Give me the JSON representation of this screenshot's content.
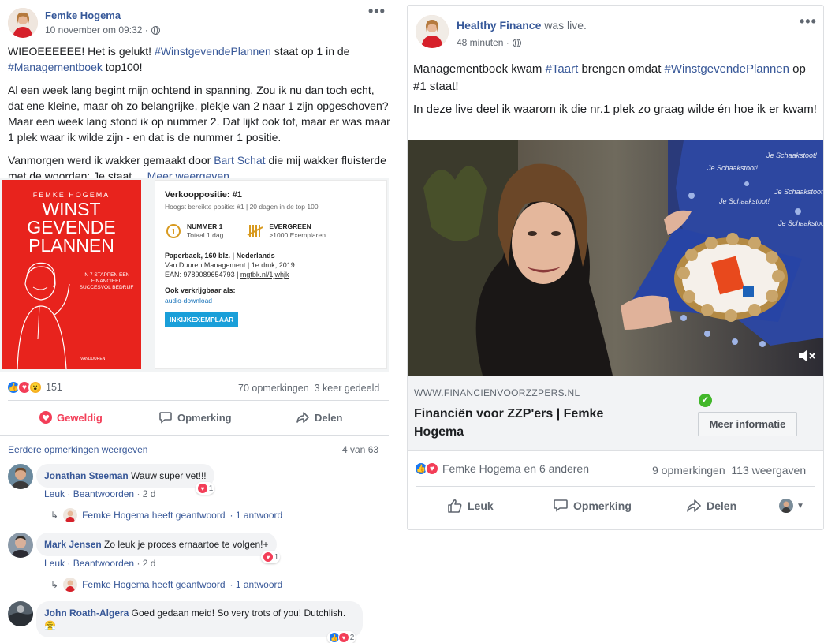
{
  "left_post": {
    "author": "Femke Hogema",
    "timestamp": "10 november om 09:32 ·",
    "more": "•••",
    "p1_a": "WIEOEEEEEE! Het is gelukt! ",
    "p1_tag1": "#WinstgevendePlannen",
    "p1_b": " staat op 1 in de ",
    "p1_tag2": "#Managementboek",
    "p1_c": " top100!",
    "p2": "Al een week lang begint mijn ochtend in spanning. Zou ik nu dan toch echt, dat ene kleine, maar oh zo belangrijke, plekje van 2 naar 1 zijn opgeschoven? Maar een week lang stond ik op nummer 2. Dat lijkt ook tof, maar er was maar 1 plek waar ik wilde zijn - en dat is de nummer 1 positie.",
    "p3_a": "Vanmorgen werd ik wakker gemaakt door ",
    "p3_link": "Bart Schat",
    "p3_b": " die mij wakker fluisterde met de woorden: Je staat ... ",
    "p3_more": "Meer weergeven",
    "book": {
      "cover_author": "FEMKE HOGEMA",
      "cover_title_1": "WINST",
      "cover_title_2": "GEVENDE",
      "cover_title_3": "PLANNEN",
      "cover_sub": "IN 7 STAPPEN EEN FINANCIEEL SUCCESVOL BEDRIJF",
      "cover_publisher": "VANDUUREN",
      "sales_title": "Verkooppositie: #1",
      "sales_sub": "Hoogst bereikte positie: #1 | 20 dagen in de top 100",
      "badge1_title": "NUMMER 1",
      "badge1_sub": "Totaal 1 dag",
      "badge2_title": "EVERGREEN",
      "badge2_sub": ">1000 Exemplaren",
      "format": "Paperback, 160 blz. | Nederlands",
      "publisher": "Van Duuren Management | 1e druk, 2019",
      "ean_label": "EAN: 9789089654793 | ",
      "ean_link": "mgtbk.nl/1jwhjk",
      "also": "Ook verkrijgbaar als:",
      "audio": "audio-download",
      "button": "INKIJKEXEMPLAAR"
    },
    "reaction_count": "151",
    "comments_count": "70 opmerkingen",
    "shares_count": "3 keer gedeeld",
    "action_love": "Geweldig",
    "action_comment": "Opmerking",
    "action_share": "Delen",
    "earlier_comments": "Eerdere opmerkingen weergeven",
    "page_count": "4 van 63",
    "comments": [
      {
        "name": "Jonathan Steeman",
        "text": " Wauw super vet!!!",
        "like": "Leuk",
        "reply": "Beantwoorden",
        "age": "· 2 d",
        "reacts": "1",
        "reply_name": "Femke Hogema heeft geantwoord",
        "reply_count": "· 1 antwoord"
      },
      {
        "name": "Mark Jensen",
        "text": " Zo leuk je proces ernaartoe te volgen!+",
        "like": "Leuk",
        "reply": "Beantwoorden",
        "age": "· 2 d",
        "reacts": "1",
        "reply_name": "Femke Hogema heeft geantwoord",
        "reply_count": "· 1 antwoord"
      },
      {
        "name": "John Roath-Algera",
        "text": " Goed gedaan meid! So very trots of you! Dutchlish. 😤",
        "reacts": "2"
      }
    ]
  },
  "right_post": {
    "author": "Healthy Finance",
    "status": " was live.",
    "timestamp": "48 minuten ·",
    "more": "•••",
    "p1_a": "Managementboek kwam ",
    "p1_tag1": "#Taart",
    "p1_b": " brengen omdat ",
    "p1_tag2": "#WinstgevendePlannen",
    "p1_c": " op #1 staat!",
    "p2": "In deze live deel ik waarom ik die nr.1 plek zo graag wilde én hoe ik er kwam!",
    "link_domain": "WWW.FINANCIENVOORZZPERS.NL",
    "link_title": "Financiën voor ZZP'ers | Femke Hogema",
    "more_info": "Meer informatie",
    "reactions_text": "Femke Hogema en 6 anderen",
    "comments_count": "9 opmerkingen",
    "views_count": "113 weergaven",
    "action_like": "Leuk",
    "action_comment": "Opmerking",
    "action_share": "Delen"
  },
  "colors": {
    "link": "#385898",
    "love": "#f33e58",
    "like": "#1877f2",
    "cover_red": "#e8231d",
    "button_blue": "#1a9fd9"
  }
}
